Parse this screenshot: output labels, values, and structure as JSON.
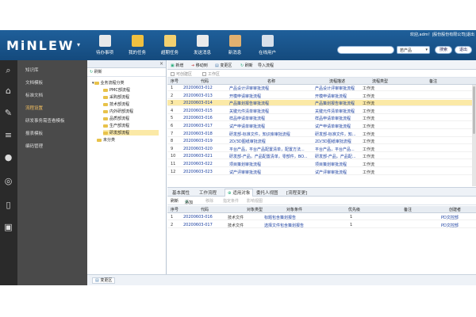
{
  "app": {
    "logo": "MiNLEW",
    "user_line": "欢迎,adm！|股份股份有限公司|退出",
    "product_select": "若产品",
    "search_button": "搜索",
    "login_button": "退出"
  },
  "toolbar_top": [
    {
      "label": "待办事项",
      "icon": "todo-icon",
      "color": "#e9e9e9"
    },
    {
      "label": "我的任务",
      "icon": "task-icon",
      "color": "#f0c040"
    },
    {
      "label": "超期任务",
      "icon": "overdue-icon",
      "color": "#f3d070"
    },
    {
      "label": "发送消息",
      "icon": "mail-icon",
      "color": "#eaeaea"
    },
    {
      "label": "新消息",
      "icon": "message-icon",
      "color": "#e0b070"
    },
    {
      "label": "在线用户",
      "icon": "users-icon",
      "color": "#d8e0ea"
    }
  ],
  "sidebar_icons": [
    "search-icon",
    "home-icon",
    "edit-icon",
    "database-icon",
    "chat-icon",
    "radio-icon",
    "book-icon",
    "card-icon"
  ],
  "menu": [
    {
      "label": "知识库",
      "active": false
    },
    {
      "label": "文档模板",
      "active": false
    },
    {
      "label": "标准文档",
      "active": false
    },
    {
      "label": "流程设置",
      "active": true
    },
    {
      "label": "研发事务需查看模板",
      "active": false
    },
    {
      "label": "报表模板",
      "active": false
    },
    {
      "label": "编码管理",
      "active": false
    }
  ],
  "tree": {
    "refresh": "刷新",
    "root": "业务流程分类",
    "children": [
      "PMC部流程",
      "采购部流程",
      "技术部流程",
      "内外研部流程",
      "品质部流程",
      "生产部流程",
      "研发部流程"
    ],
    "other": "未分类"
  },
  "right_toolbar": [
    "新增",
    "移动到",
    "变更区",
    "刷新",
    "导入流程"
  ],
  "filter": [
    "可创建区",
    "工作区"
  ],
  "columns": [
    "序号",
    "代码",
    "名称",
    "流程描述",
    "流程类型",
    "备注"
  ],
  "rows": [
    {
      "n": "1",
      "code": "20200603-012",
      "name": "产品设计评审审批流程",
      "desc": "产品设计评审审批流程",
      "type": "工作流"
    },
    {
      "n": "2",
      "code": "20200603-013",
      "name": "开模申请审批流程",
      "desc": "开模申请审批流程",
      "type": "工作流"
    },
    {
      "n": "3",
      "code": "20200603-014",
      "name": "产品策划报告审批流程",
      "desc": "产品策划报告审批流程",
      "type": "工作流"
    },
    {
      "n": "4",
      "code": "20200603-015",
      "name": "关键元件清单审批流程",
      "desc": "关键元件清单审批流程",
      "type": "工作流"
    },
    {
      "n": "5",
      "code": "20200603-016",
      "name": "样品申请单审批流程",
      "desc": "样品申请单审批流程",
      "type": "工作流"
    },
    {
      "n": "6",
      "code": "20200603-017",
      "name": "试产申请单审批流程",
      "desc": "试产申请单审批流程",
      "type": "工作流"
    },
    {
      "n": "7",
      "code": "20200603-018",
      "name": "研发部-标准文件，知识库审批流程",
      "desc": "研发部-标准文件，知...",
      "type": "工作流"
    },
    {
      "n": "8",
      "code": "20200603-019",
      "name": "2D/3D图纸审批流程",
      "desc": "2D/3D图纸审批流程",
      "type": "工作流"
    },
    {
      "n": "9",
      "code": "20200603-020",
      "name": "平台产品，平台产品配置清单，配置方法...",
      "desc": "平台产品，平台产品...",
      "type": "工作流"
    },
    {
      "n": "10",
      "code": "20200603-021",
      "name": "研发部-产品，产品配置清单，零部件，BO...",
      "desc": "研发部-产品，产品配...",
      "type": "工作流"
    },
    {
      "n": "11",
      "code": "20200603-022",
      "name": "项目策划审批流程",
      "desc": "项目策划审批流程",
      "type": "工作流"
    },
    {
      "n": "12",
      "code": "20200603-023",
      "name": "试产评审审批流程",
      "desc": "试产评审审批流程",
      "type": "工作流"
    }
  ],
  "tabs": [
    "基本属性",
    "工作流程",
    "适用对象",
    "委托人视图",
    "[流程变更]"
  ],
  "active_tab": "适用对象",
  "sub_toolbar": [
    {
      "label": "刷新",
      "disabled": false
    },
    {
      "label": "添加",
      "disabled": false
    },
    {
      "label": "移除",
      "disabled": true
    },
    {
      "label": "指定条件",
      "disabled": true
    },
    {
      "label": "影响视图",
      "disabled": true
    }
  ],
  "sub_columns": [
    "序号",
    "代码",
    "对象类型",
    "对象条件",
    "优先级",
    "备注",
    "创建者"
  ],
  "sub_rows": [
    {
      "n": "1",
      "code": "20200603-016",
      "type": "技术文件",
      "cond": "标题包含策划报告",
      "prio": "1",
      "creator": "PD文控部"
    },
    {
      "n": "2",
      "code": "20200603-017",
      "type": "技术文件",
      "cond": "选择文件包含策划报告",
      "prio": "1",
      "creator": "PD文控部"
    }
  ],
  "status": "变更区"
}
